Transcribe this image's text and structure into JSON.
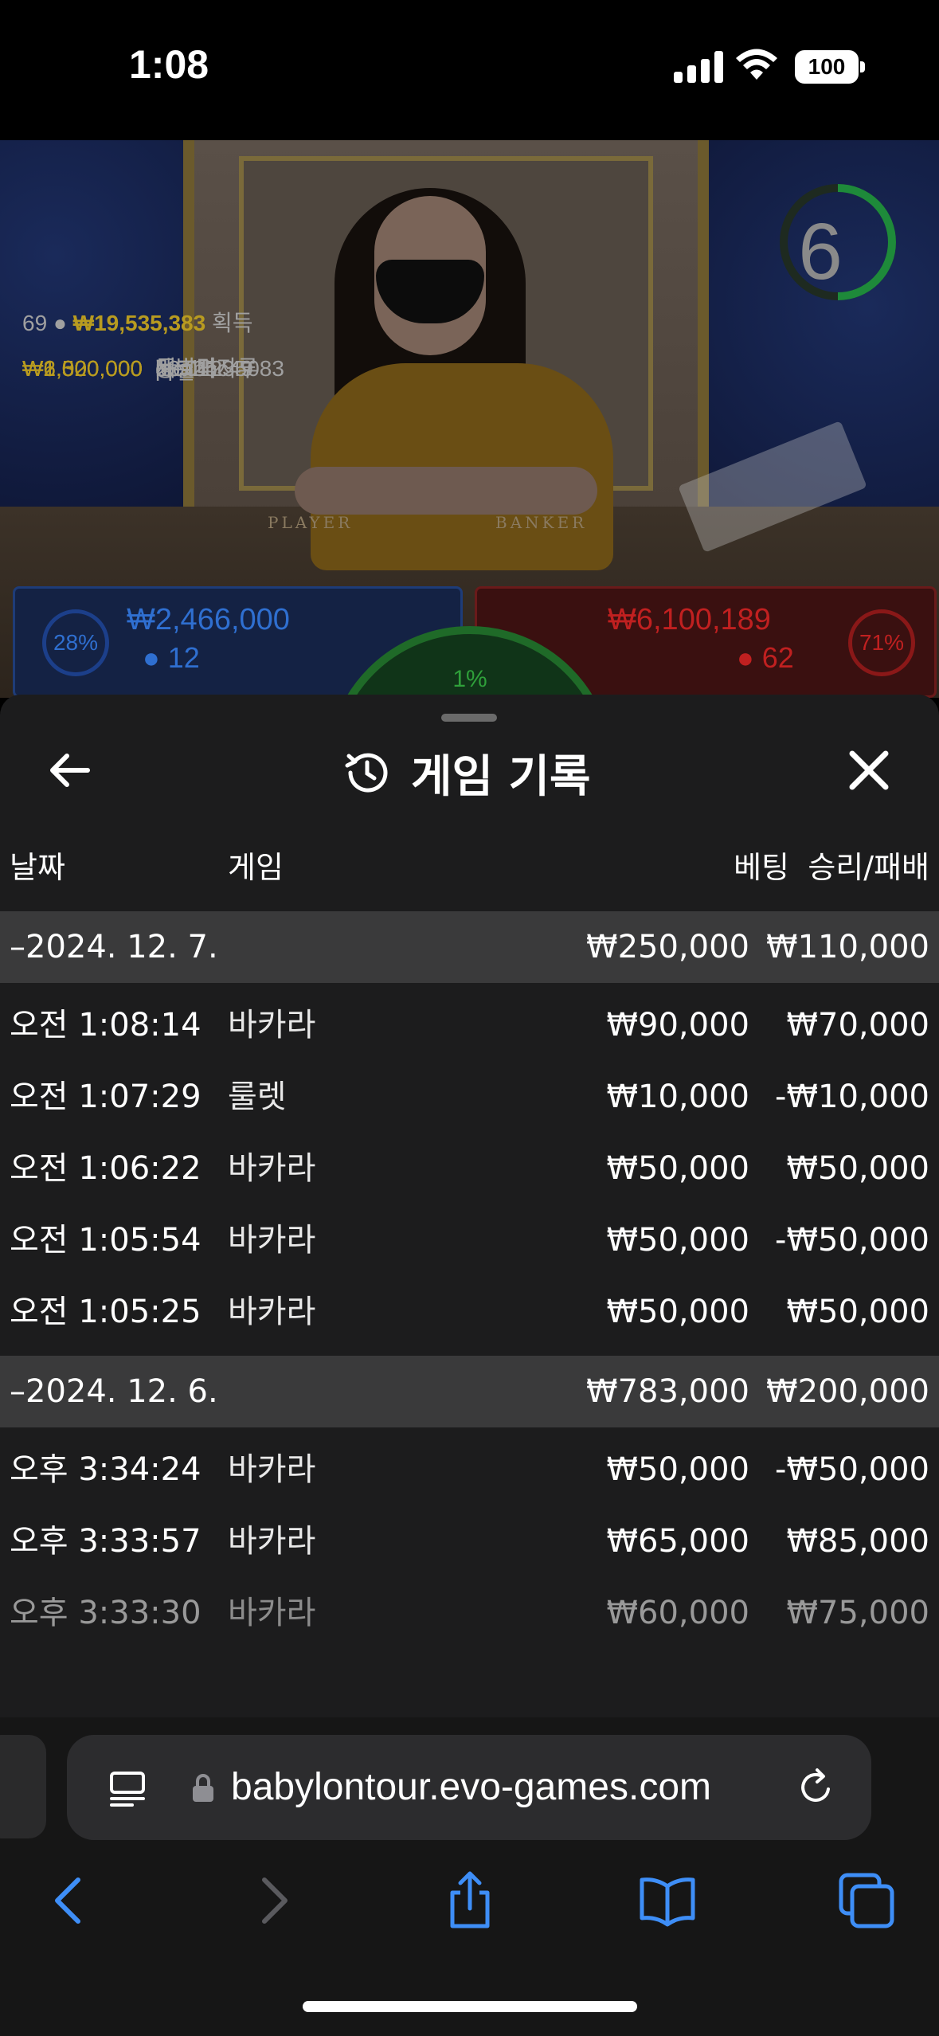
{
  "status": {
    "time": "1:08",
    "battery": "100"
  },
  "video": {
    "timer": "6",
    "table_player": "PLAYER",
    "table_banker": "BANKER",
    "winners_count": "69",
    "winners_total": "₩19,535,383",
    "winners_suffix": "획득",
    "winners": [
      {
        "amount": "₩6,000,000",
        "name": "ppa25"
      },
      {
        "amount": "₩2,300,000",
        "name": "제발먹자루"
      },
      {
        "amount": "₩1,520,000",
        "name": "lee01235083"
      },
      {
        "amount": "₩1,000,000",
        "name": "d3_bhc49"
      },
      {
        "amount": "₩1,000,000",
        "name": "동호다"
      }
    ],
    "player": {
      "pct": "28%",
      "amount": "₩2,466,000",
      "count": "12"
    },
    "banker": {
      "pct": "71%",
      "amount": "₩6,100,189",
      "count": "62"
    },
    "tie": {
      "pct": "1%"
    }
  },
  "sheet": {
    "title": "게임 기록",
    "headers": {
      "date": "날짜",
      "game": "게임",
      "bet": "베팅",
      "winloss": "승리/패배"
    },
    "groups": [
      {
        "date": "–2024. 12. 7.",
        "bet": "₩250,000",
        "winloss": "₩110,000",
        "rows": [
          {
            "time": "오전 1:08:14",
            "game": "바카라",
            "bet": "₩90,000",
            "winloss": "₩70,000"
          },
          {
            "time": "오전 1:07:29",
            "game": "룰렛",
            "bet": "₩10,000",
            "winloss": "-₩10,000"
          },
          {
            "time": "오전 1:06:22",
            "game": "바카라",
            "bet": "₩50,000",
            "winloss": "₩50,000"
          },
          {
            "time": "오전 1:05:54",
            "game": "바카라",
            "bet": "₩50,000",
            "winloss": "-₩50,000"
          },
          {
            "time": "오전 1:05:25",
            "game": "바카라",
            "bet": "₩50,000",
            "winloss": "₩50,000"
          }
        ]
      },
      {
        "date": "–2024. 12. 6.",
        "bet": "₩783,000",
        "winloss": "₩200,000",
        "rows": [
          {
            "time": "오후 3:34:24",
            "game": "바카라",
            "bet": "₩50,000",
            "winloss": "-₩50,000"
          },
          {
            "time": "오후 3:33:57",
            "game": "바카라",
            "bet": "₩65,000",
            "winloss": "₩85,000"
          },
          {
            "time": "오후 3:33:30",
            "game": "바카라",
            "bet": "₩60,000",
            "winloss": "₩75,000"
          }
        ]
      }
    ]
  },
  "browser": {
    "url": "babylontour.evo-games.com"
  },
  "colors": {
    "accent_blue": "#3e8ef7",
    "player_blue": "#2f6fd0",
    "banker_red": "#c02020",
    "winner_gold": "#b89b20"
  }
}
